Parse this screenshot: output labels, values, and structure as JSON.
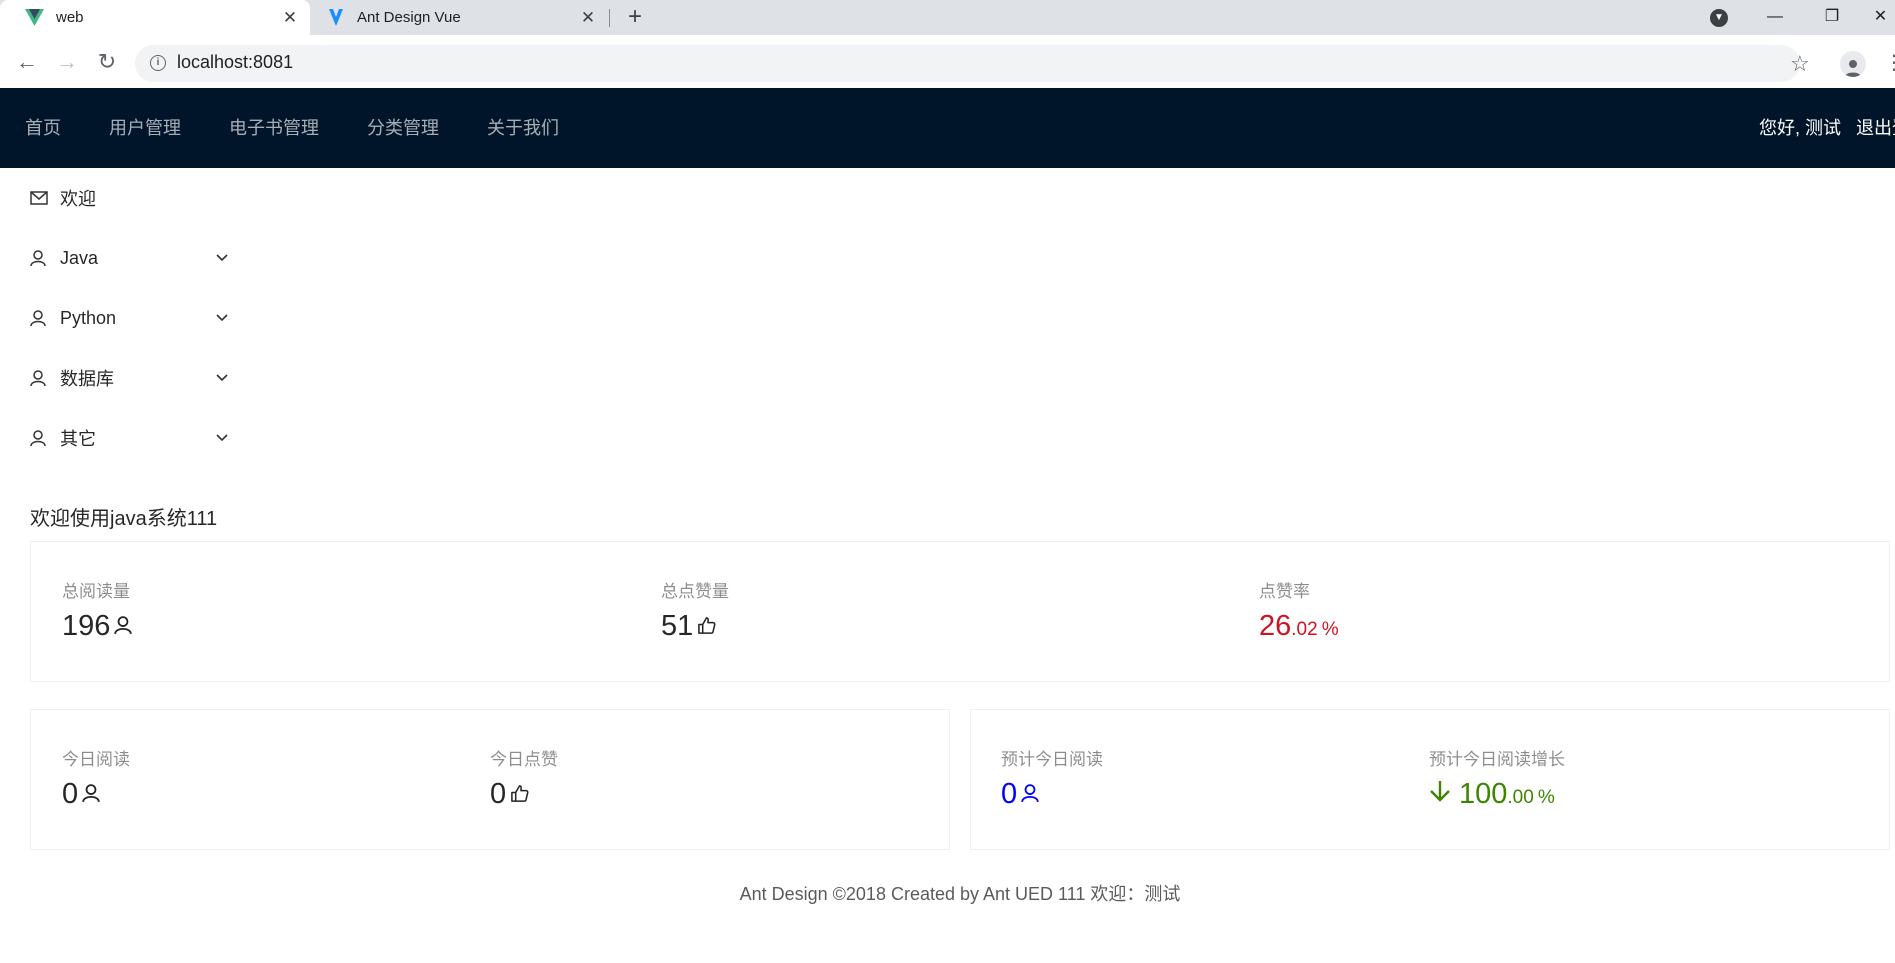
{
  "browser": {
    "tabs": [
      {
        "title": "web",
        "close": "✕"
      },
      {
        "title": "Ant Design Vue",
        "close": "✕"
      }
    ],
    "new_tab": "+",
    "window": {
      "minimize": "—",
      "restore": "❐",
      "close": "✕"
    },
    "url": "localhost:8081"
  },
  "header": {
    "menu": [
      "首页",
      "用户管理",
      "电子书管理",
      "分类管理",
      "关于我们"
    ],
    "greeting": "您好, 测试",
    "logout": "退出登录"
  },
  "sidebar": {
    "items": [
      {
        "label": "欢迎",
        "icon": "mail-icon",
        "has_arrow": false
      },
      {
        "label": "Java",
        "icon": "user-icon",
        "has_arrow": true
      },
      {
        "label": "Python",
        "icon": "user-icon",
        "has_arrow": true
      },
      {
        "label": "数据库",
        "icon": "user-icon",
        "has_arrow": true
      },
      {
        "label": "其它",
        "icon": "user-icon",
        "has_arrow": true
      }
    ]
  },
  "main": {
    "welcome": "欢迎使用java系统111",
    "overall": [
      {
        "title": "总阅读量",
        "value": "196",
        "icon": "user-icon"
      },
      {
        "title": "总点赞量",
        "value": "51",
        "icon": "like-icon"
      },
      {
        "title": "点赞率",
        "value_int": "26",
        "value_dec": ".02",
        "suffix": "%"
      }
    ],
    "today": [
      {
        "title": "今日阅读",
        "value": "0",
        "icon": "user-icon"
      },
      {
        "title": "今日点赞",
        "value": "0",
        "icon": "like-icon"
      }
    ],
    "forecast": [
      {
        "title": "预计今日阅读",
        "value": "0",
        "icon": "user-icon"
      },
      {
        "title": "预计今日阅读增长",
        "value_int": "100",
        "value_dec": ".00",
        "suffix": "%",
        "icon": "arrow-down-icon"
      }
    ]
  },
  "footer": {
    "text": "Ant Design ©2018 Created by Ant UED 111 欢迎：测试"
  },
  "colors": {
    "header_bg": "#001529",
    "red": "#cf1322",
    "blue": "#0000ff",
    "green": "#3f8600"
  }
}
